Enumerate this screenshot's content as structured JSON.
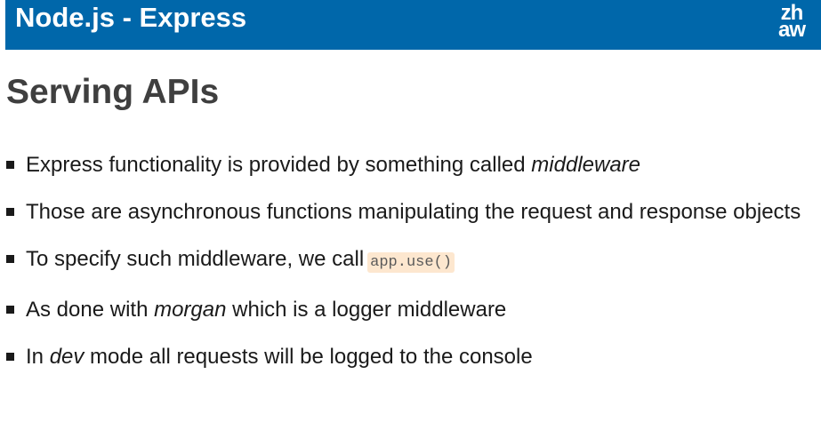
{
  "header": {
    "title": "Node.js - Express",
    "logo_line1": "zh",
    "logo_line2": "aw",
    "background_color": "#0067aa"
  },
  "slide": {
    "title": "Serving APIs",
    "bullets": [
      {
        "text_before": "Express functionality is provided by something called ",
        "emphasis": "middleware"
      },
      {
        "text": "Those are asynchronous functions manipulating the request and response objects"
      },
      {
        "text_before": "To specify such middleware, we call",
        "code": "app.use()"
      },
      {
        "text_before": "As done with ",
        "emphasis": "morgan",
        "text_after": " which is a logger middleware"
      },
      {
        "text_before": "In ",
        "emphasis": "dev",
        "text_after": " mode all requests will be logged to the console"
      }
    ]
  }
}
